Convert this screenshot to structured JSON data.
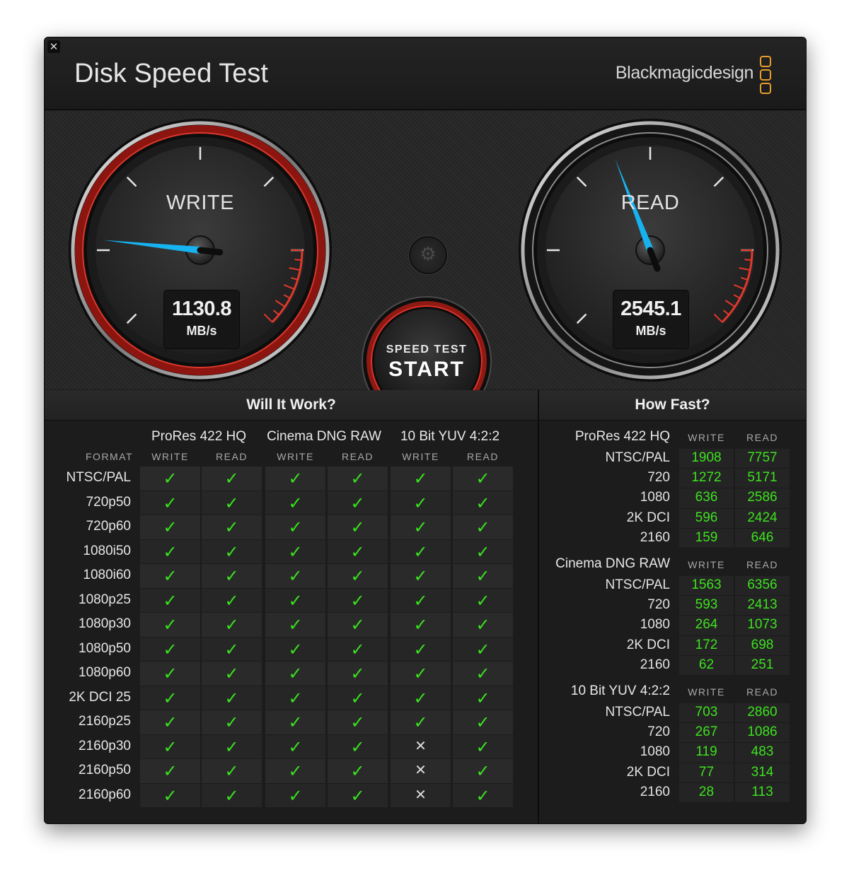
{
  "window": {
    "title": "Disk Speed Test",
    "brand": "Blackmagicdesign",
    "close_glyph": "✕",
    "close_icon": "close-icon",
    "brand_icon": "blackmagic-logo-icon",
    "accent": "#e79b2b"
  },
  "gauges": {
    "write": {
      "label": "WRITE",
      "value": "1130.8",
      "unit": "MB/s"
    },
    "read": {
      "label": "READ",
      "value": "2545.1",
      "unit": "MB/s"
    },
    "needle_color": "#17b3f0",
    "write_ring_color": "#c9251c"
  },
  "settings": {
    "icon": "gear-icon",
    "glyph": "⚙"
  },
  "start": {
    "line1": "SPEED TEST",
    "line2": "START"
  },
  "will_it_work": {
    "title": "Will It Work?",
    "format_label": "FORMAT",
    "groups": [
      {
        "name": "ProRes 422 HQ",
        "write": "WRITE",
        "read": "READ"
      },
      {
        "name": "Cinema DNG RAW",
        "write": "WRITE",
        "read": "READ"
      },
      {
        "name": "10 Bit YUV 4:2:2",
        "write": "WRITE",
        "read": "READ"
      }
    ],
    "rows": [
      {
        "format": "NTSC/PAL",
        "marks": [
          "✓",
          "✓",
          "✓",
          "✓",
          "✓",
          "✓"
        ]
      },
      {
        "format": "720p50",
        "marks": [
          "✓",
          "✓",
          "✓",
          "✓",
          "✓",
          "✓"
        ]
      },
      {
        "format": "720p60",
        "marks": [
          "✓",
          "✓",
          "✓",
          "✓",
          "✓",
          "✓"
        ]
      },
      {
        "format": "1080i50",
        "marks": [
          "✓",
          "✓",
          "✓",
          "✓",
          "✓",
          "✓"
        ]
      },
      {
        "format": "1080i60",
        "marks": [
          "✓",
          "✓",
          "✓",
          "✓",
          "✓",
          "✓"
        ]
      },
      {
        "format": "1080p25",
        "marks": [
          "✓",
          "✓",
          "✓",
          "✓",
          "✓",
          "✓"
        ]
      },
      {
        "format": "1080p30",
        "marks": [
          "✓",
          "✓",
          "✓",
          "✓",
          "✓",
          "✓"
        ]
      },
      {
        "format": "1080p50",
        "marks": [
          "✓",
          "✓",
          "✓",
          "✓",
          "✓",
          "✓"
        ]
      },
      {
        "format": "1080p60",
        "marks": [
          "✓",
          "✓",
          "✓",
          "✓",
          "✓",
          "✓"
        ]
      },
      {
        "format": "2K DCI 25",
        "marks": [
          "✓",
          "✓",
          "✓",
          "✓",
          "✓",
          "✓"
        ]
      },
      {
        "format": "2160p25",
        "marks": [
          "✓",
          "✓",
          "✓",
          "✓",
          "✓",
          "✓"
        ]
      },
      {
        "format": "2160p30",
        "marks": [
          "✓",
          "✓",
          "✓",
          "✓",
          "✕",
          "✓"
        ]
      },
      {
        "format": "2160p50",
        "marks": [
          "✓",
          "✓",
          "✓",
          "✓",
          "✕",
          "✓"
        ]
      },
      {
        "format": "2160p60",
        "marks": [
          "✓",
          "✓",
          "✓",
          "✓",
          "✕",
          "✓"
        ]
      }
    ]
  },
  "how_fast": {
    "title": "How Fast?",
    "write_label": "WRITE",
    "read_label": "READ",
    "groups": [
      {
        "name": "ProRes 422 HQ",
        "rows": [
          {
            "format": "NTSC/PAL",
            "write": "1908",
            "read": "7757"
          },
          {
            "format": "720",
            "write": "1272",
            "read": "5171"
          },
          {
            "format": "1080",
            "write": "636",
            "read": "2586"
          },
          {
            "format": "2K DCI",
            "write": "596",
            "read": "2424"
          },
          {
            "format": "2160",
            "write": "159",
            "read": "646"
          }
        ]
      },
      {
        "name": "Cinema DNG RAW",
        "rows": [
          {
            "format": "NTSC/PAL",
            "write": "1563",
            "read": "6356"
          },
          {
            "format": "720",
            "write": "593",
            "read": "2413"
          },
          {
            "format": "1080",
            "write": "264",
            "read": "1073"
          },
          {
            "format": "2K DCI",
            "write": "172",
            "read": "698"
          },
          {
            "format": "2160",
            "write": "62",
            "read": "251"
          }
        ]
      },
      {
        "name": "10 Bit YUV 4:2:2",
        "rows": [
          {
            "format": "NTSC/PAL",
            "write": "703",
            "read": "2860"
          },
          {
            "format": "720",
            "write": "267",
            "read": "1086"
          },
          {
            "format": "1080",
            "write": "119",
            "read": "483"
          },
          {
            "format": "2K DCI",
            "write": "77",
            "read": "314"
          },
          {
            "format": "2160",
            "write": "28",
            "read": "113"
          }
        ]
      }
    ]
  }
}
